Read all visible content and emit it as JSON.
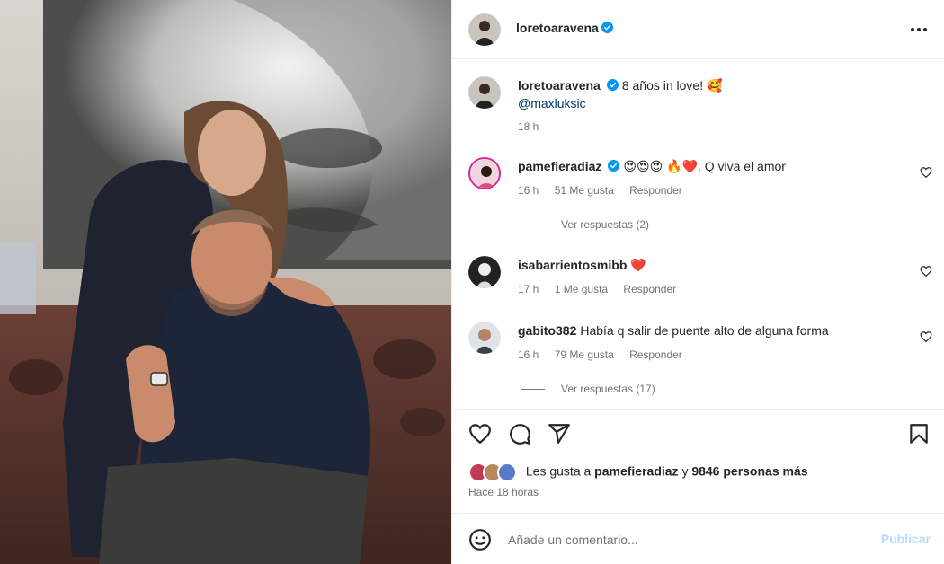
{
  "photo": {
    "alt_subject": "couple-photo"
  },
  "header": {
    "username": "loretoaravena",
    "verified": true,
    "more_icon": "more-horizontal-icon"
  },
  "caption": {
    "username": "loretoaravena",
    "text": "8 años in love! 🥰",
    "mention": "@maxluksic",
    "time": "18 h"
  },
  "comments": [
    {
      "username": "pamefieradiaz",
      "verified": true,
      "text": "😍😍😍 🔥❤️. Q viva el amor",
      "time": "16 h",
      "likes": "51 Me gusta",
      "reply_label": "Responder",
      "view_replies": "Ver respuestas (2)"
    },
    {
      "username": "isabarrientosmibb",
      "verified": false,
      "text": "❤️",
      "time": "17 h",
      "likes": "1 Me gusta",
      "reply_label": "Responder"
    },
    {
      "username": "gabito382",
      "verified": false,
      "text": "Había q salir de puente alto de alguna forma",
      "time": "16 h",
      "likes": "79 Me gusta",
      "reply_label": "Responder",
      "view_replies": "Ver respuestas (17)"
    }
  ],
  "actions": {
    "like_icon": "heart-icon",
    "comment_icon": "comment-icon",
    "share_icon": "share-icon",
    "save_icon": "bookmark-icon"
  },
  "likes": {
    "prefix": "Les gusta a",
    "first_user": "pamefieradiaz",
    "connector": "y",
    "others": "9846 personas más"
  },
  "time_ago": "Hace 18 horas",
  "add_comment": {
    "placeholder": "Añade un comentario...",
    "publish_label": "Publicar"
  },
  "colors": {
    "verified_blue": "#0095f6",
    "mention": "#00376b",
    "muted": "#737373",
    "publish_disabled": "#b3dbff"
  }
}
